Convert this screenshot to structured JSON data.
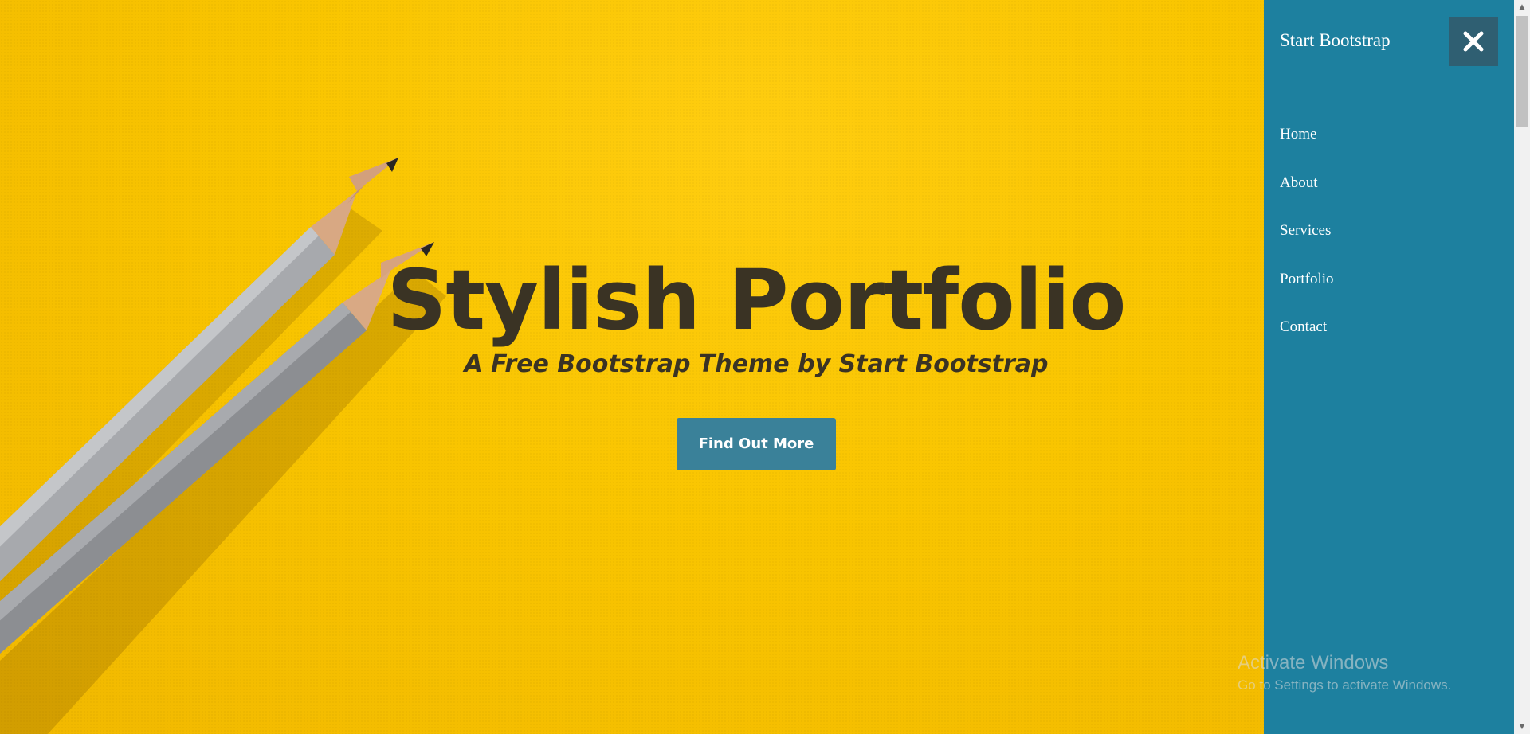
{
  "hero": {
    "title": "Stylish Portfolio",
    "subtitle": "A Free Bootstrap Theme by Start Bootstrap",
    "cta_label": "Find Out More"
  },
  "sidebar": {
    "brand": "Start Bootstrap",
    "close_icon": "close-icon",
    "items": [
      {
        "label": "Home"
      },
      {
        "label": "About"
      },
      {
        "label": "Services"
      },
      {
        "label": "Portfolio"
      },
      {
        "label": "Contact"
      }
    ]
  },
  "watermark": {
    "title": "Activate Windows",
    "subtitle": "Go to Settings to activate Windows."
  },
  "colors": {
    "hero_background": "#f7c300",
    "title_text": "#3a3324",
    "button_background": "#3a8199",
    "sidebar_background": "#1d809f",
    "close_button_background": "#2f5f72"
  }
}
